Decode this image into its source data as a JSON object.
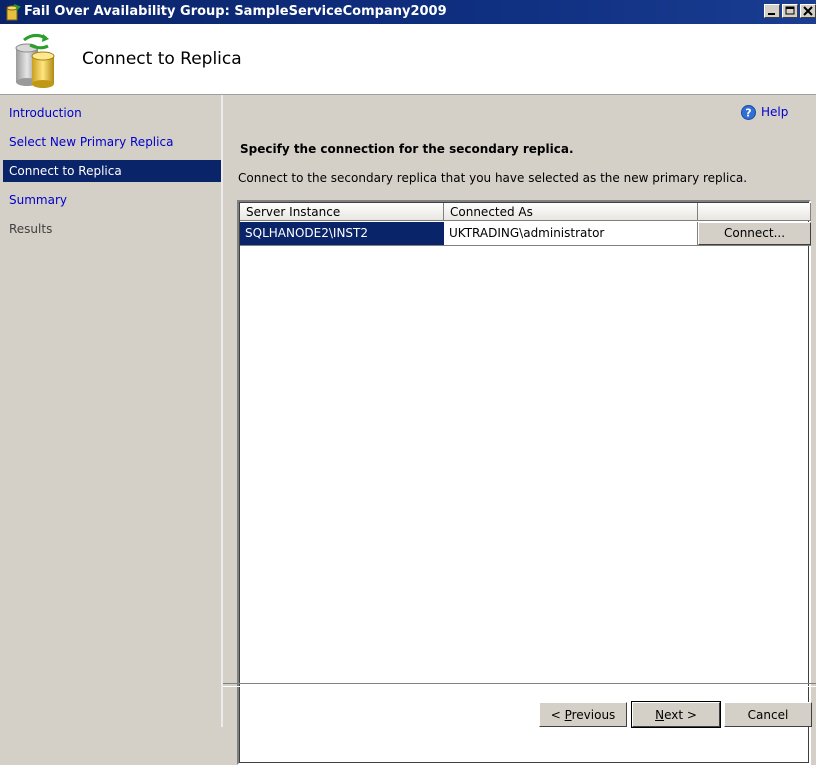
{
  "window": {
    "title": "Fail Over Availability Group: SampleServiceCompany2009",
    "controls": [
      "minimize-icon",
      "maximize-icon",
      "close-icon"
    ]
  },
  "header": {
    "title": "Connect to Replica",
    "icon": "database-sync-icon"
  },
  "sidebar": {
    "items": [
      {
        "label": "Introduction",
        "state": "link"
      },
      {
        "label": "Select New Primary Replica",
        "state": "link"
      },
      {
        "label": "Connect to Replica",
        "state": "active"
      },
      {
        "label": "Summary",
        "state": "link"
      },
      {
        "label": "Results",
        "state": "disabled"
      }
    ]
  },
  "main": {
    "help_label": "Help",
    "heading": "Specify the connection for the secondary replica.",
    "description": "Connect to the secondary replica that you have selected as the new primary replica.",
    "grid": {
      "columns": [
        "Server Instance",
        "Connected As",
        ""
      ],
      "rows": [
        {
          "server_instance": "SQLHANODE2\\INST2",
          "connected_as": "UKTRADING\\administrator",
          "action": "Connect..."
        }
      ]
    }
  },
  "footer": {
    "previous_prefix": "< ",
    "previous_key": "P",
    "previous_rest": "revious",
    "next_key": "N",
    "next_rest": "ext >",
    "cancel_label": "Cancel"
  },
  "colors": {
    "titlebar": "#0a246a",
    "selection": "#0a246a",
    "link": "#0000cc",
    "chrome": "#d4d0c8"
  }
}
